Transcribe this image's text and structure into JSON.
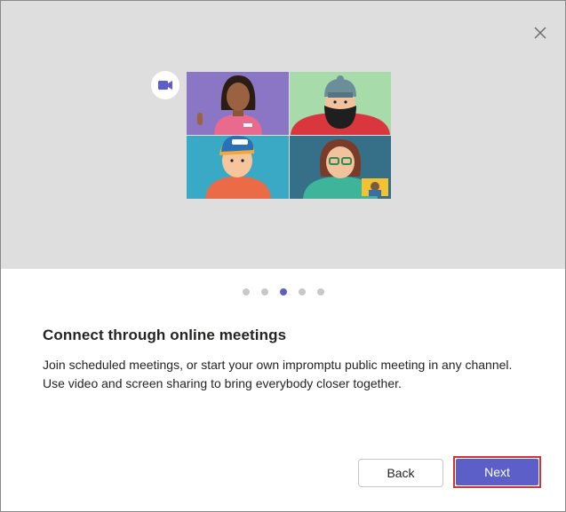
{
  "dialog": {
    "close_icon": "close-icon",
    "carousel": {
      "total_pages": 5,
      "current_page": 3
    },
    "title": "Connect through online meetings",
    "description": "Join scheduled meetings, or start your own impromptu public meeting in any channel. Use video and screen sharing to bring everybody closer together.",
    "back_label": "Back",
    "next_label": "Next",
    "colors": {
      "accent": "#5b5fc7",
      "highlight_border": "#d13438",
      "hero_background": "#dedede"
    }
  }
}
